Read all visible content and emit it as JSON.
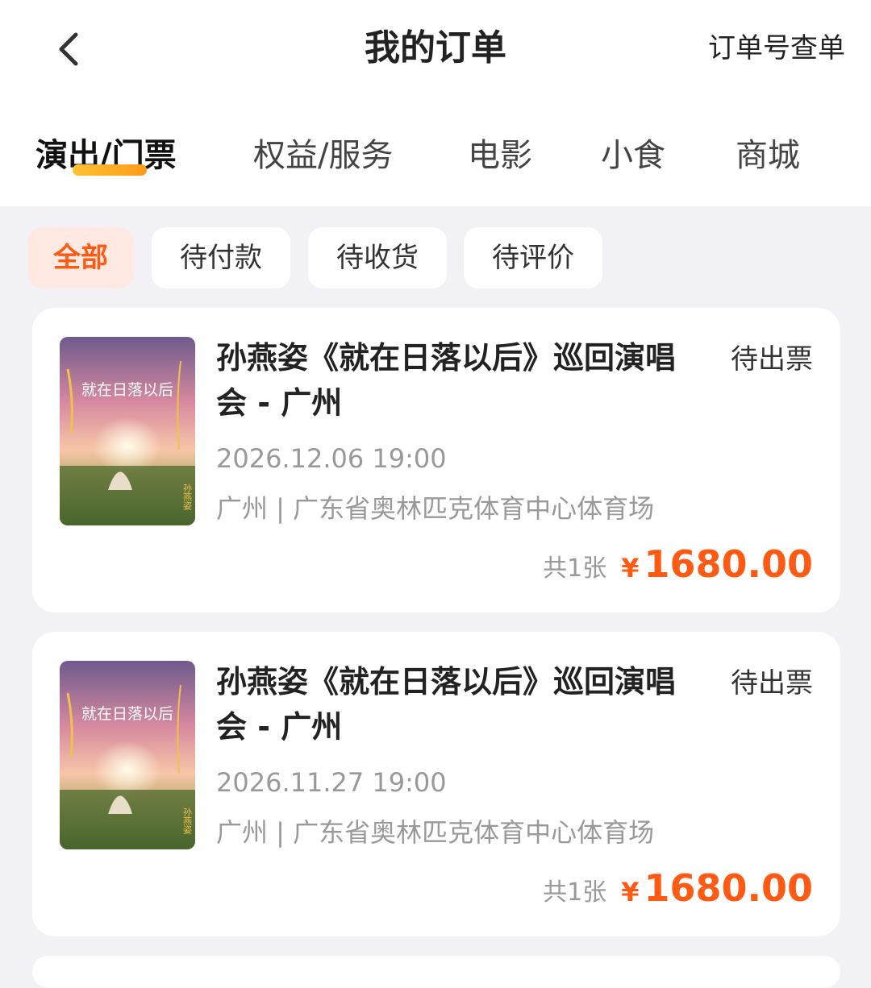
{
  "header": {
    "title": "我的订单",
    "order_lookup": "订单号查单"
  },
  "tabs": [
    {
      "label": "演出/门票",
      "active": true
    },
    {
      "label": "权益/服务",
      "active": false
    },
    {
      "label": "电影",
      "active": false
    },
    {
      "label": "小食",
      "active": false
    },
    {
      "label": "商城",
      "active": false
    }
  ],
  "filters": [
    {
      "label": "全部",
      "active": true
    },
    {
      "label": "待付款",
      "active": false
    },
    {
      "label": "待收货",
      "active": false
    },
    {
      "label": "待评价",
      "active": false
    }
  ],
  "orders": [
    {
      "title": "孙燕姿《就在日落以后》巡回演唱会 - 广州",
      "status": "待出票",
      "datetime": "2026.12.06 19:00",
      "venue": "广州 | 广东省奥林匹克体育中心体育场",
      "count": "共1张",
      "currency": "¥",
      "amount": "1680.00",
      "poster": {
        "title": "就在日落以后",
        "artist": "孙燕姿"
      }
    },
    {
      "title": "孙燕姿《就在日落以后》巡回演唱会 - 广州",
      "status": "待出票",
      "datetime": "2026.11.27 19:00",
      "venue": "广州 | 广东省奥林匹克体育中心体育场",
      "count": "共1张",
      "currency": "¥",
      "amount": "1680.00",
      "poster": {
        "title": "就在日落以后",
        "artist": "孙燕姿"
      }
    }
  ],
  "colors": {
    "accent": "#ff5a14",
    "tab_underline": "#ffb020",
    "background": "#f2f2f6"
  }
}
